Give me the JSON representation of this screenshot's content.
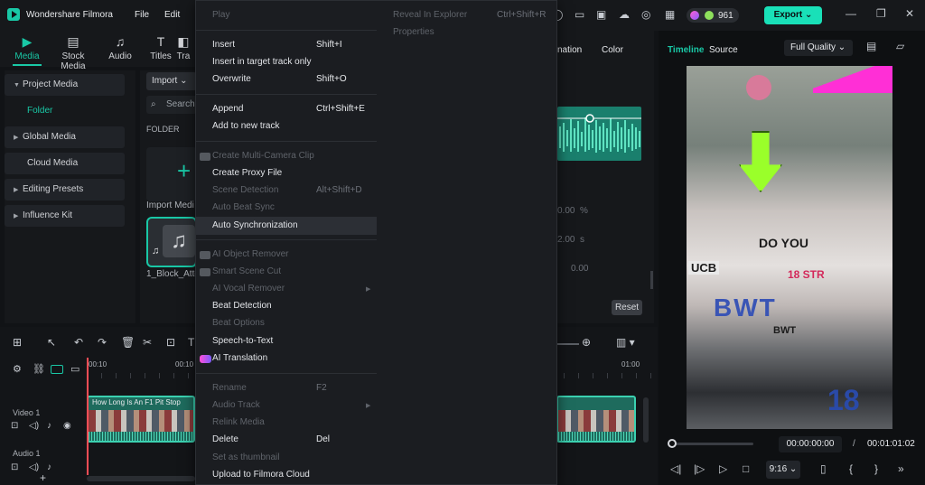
{
  "app": {
    "title": "Wondershare Filmora",
    "menus": [
      "File",
      "Edit"
    ]
  },
  "top_tabs": [
    {
      "label": "Media",
      "icon": "media-icon"
    },
    {
      "label": "Stock Media",
      "icon": "stock-media-icon"
    },
    {
      "label": "Audio",
      "icon": "music-note-icon"
    },
    {
      "label": "Titles",
      "icon": "text-icon"
    },
    {
      "label": "Tra",
      "icon": "transition-icon"
    }
  ],
  "sidebar": {
    "items": [
      {
        "label": "Project Media",
        "has_arrow": true
      },
      {
        "label": "Folder",
        "has_arrow": false,
        "active": true
      },
      {
        "label": "Global Media",
        "has_arrow": true
      },
      {
        "label": "Cloud Media",
        "has_arrow": false
      },
      {
        "label": "Editing Presets",
        "has_arrow": true
      },
      {
        "label": "Influence Kit",
        "has_arrow": true
      }
    ]
  },
  "media_panel": {
    "import_label": "Import",
    "search_placeholder": "Search",
    "folder_header": "FOLDER",
    "import_media_label": "Import Medi",
    "file_name": "1_Block_Atte"
  },
  "right_tabs": {
    "animation": "nation",
    "color": "Color"
  },
  "properties": {
    "val1": "0.00",
    "unit1": "%",
    "val2": "2.00",
    "unit2": "s",
    "val3": "0.00",
    "reset_label": "Reset"
  },
  "header_right": {
    "credits": "961",
    "export_label": "Export"
  },
  "preview": {
    "tab_timeline": "Timeline",
    "tab_source": "Source",
    "quality": "Full Quality",
    "current_time": "00:00:00:00",
    "separator": "/",
    "total_time": "00:01:01:02",
    "ratio": "9:16",
    "video_text": {
      "doyou": "DO YOU",
      "ucb": "UCB",
      "str": "18 STR",
      "bwt": "BWT",
      "bwt2": "BWT",
      "num": "18"
    }
  },
  "timeline": {
    "ruler": [
      "00:10",
      "00:10",
      "01:00"
    ],
    "tracks": [
      {
        "label": "Video 1",
        "clip_title": "How Long Is An F1 Pit Stop"
      },
      {
        "label": "Audio 1"
      }
    ]
  },
  "context_menu": {
    "top_left": "Play",
    "top_right_items": [
      {
        "label": "Reveal In Explorer",
        "shortcut": "Ctrl+Shift+R"
      },
      {
        "label": "Properties",
        "shortcut": ""
      }
    ],
    "items": [
      {
        "label": "Insert",
        "shortcut": "Shift+I",
        "enabled": true
      },
      {
        "label": "Insert in target track only",
        "shortcut": "",
        "enabled": true
      },
      {
        "label": "Overwrite",
        "shortcut": "Shift+O",
        "enabled": true
      },
      {
        "label": "Append",
        "shortcut": "Ctrl+Shift+E",
        "enabled": true
      },
      {
        "label": "Add to new track",
        "shortcut": "",
        "enabled": true
      },
      {
        "label": "Create Multi-Camera Clip",
        "shortcut": "",
        "enabled": false
      },
      {
        "label": "Create Proxy File",
        "shortcut": "",
        "enabled": true
      },
      {
        "label": "Scene Detection",
        "shortcut": "Alt+Shift+D",
        "enabled": false
      },
      {
        "label": "Auto Beat Sync",
        "shortcut": "",
        "enabled": false
      },
      {
        "label": "Auto Synchronization",
        "shortcut": "",
        "enabled": true
      },
      {
        "label": "AI Object Remover",
        "shortcut": "",
        "enabled": false
      },
      {
        "label": "Smart Scene Cut",
        "shortcut": "",
        "enabled": false
      },
      {
        "label": "AI Vocal Remover",
        "shortcut": "",
        "enabled": false
      },
      {
        "label": "Beat Detection",
        "shortcut": "",
        "enabled": true
      },
      {
        "label": "Beat Options",
        "shortcut": "",
        "enabled": false
      },
      {
        "label": "Speech-to-Text",
        "shortcut": "",
        "enabled": true
      },
      {
        "label": "AI Translation",
        "shortcut": "",
        "enabled": true
      },
      {
        "label": "Rename",
        "shortcut": "F2",
        "enabled": false
      },
      {
        "label": "Audio Track",
        "shortcut": "",
        "enabled": false
      },
      {
        "label": "Relink Media",
        "shortcut": "",
        "enabled": false
      },
      {
        "label": "Delete",
        "shortcut": "Del",
        "enabled": true
      },
      {
        "label": "Set as thumbnail",
        "shortcut": "",
        "enabled": false
      },
      {
        "label": "Upload to Filmora Cloud",
        "shortcut": "",
        "enabled": true
      }
    ]
  },
  "colors": {
    "accent": "#19c8a6",
    "export": "#19e0b8",
    "playhead": "#ff4d55"
  }
}
